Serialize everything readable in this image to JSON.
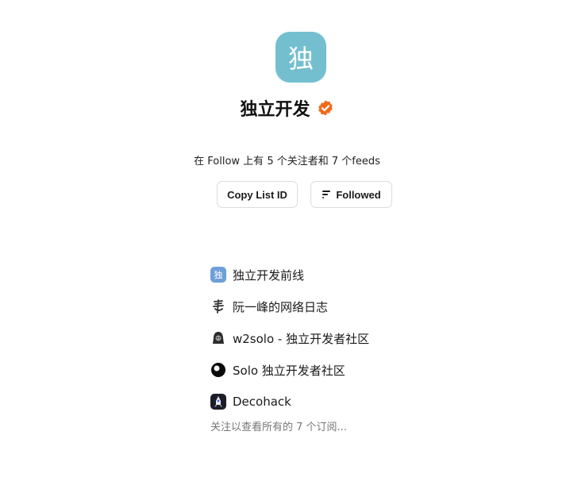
{
  "list": {
    "avatar_char": "独",
    "avatar_color": "#74bfcf",
    "title": "独立开发",
    "verified_color": "#f26a1b",
    "summary": "在 Follow 上有 5 个关注者和 7 个feeds"
  },
  "actions": {
    "copy_label": "Copy List ID",
    "follow_label": "Followed"
  },
  "feeds": [
    {
      "label": "独立开发前线",
      "icon": "feed-avatar-indie-frontline"
    },
    {
      "label": "阮一峰的网络日志",
      "icon": "feed-avatar-ruanyifeng"
    },
    {
      "label": "w2solo - 独立开发者社区",
      "icon": "feed-avatar-w2solo"
    },
    {
      "label": "Solo 独立开发者社区",
      "icon": "feed-avatar-solo"
    },
    {
      "label": "Decohack",
      "icon": "feed-avatar-decohack"
    }
  ],
  "more_note": "关注以查看所有的 7 个订阅..."
}
